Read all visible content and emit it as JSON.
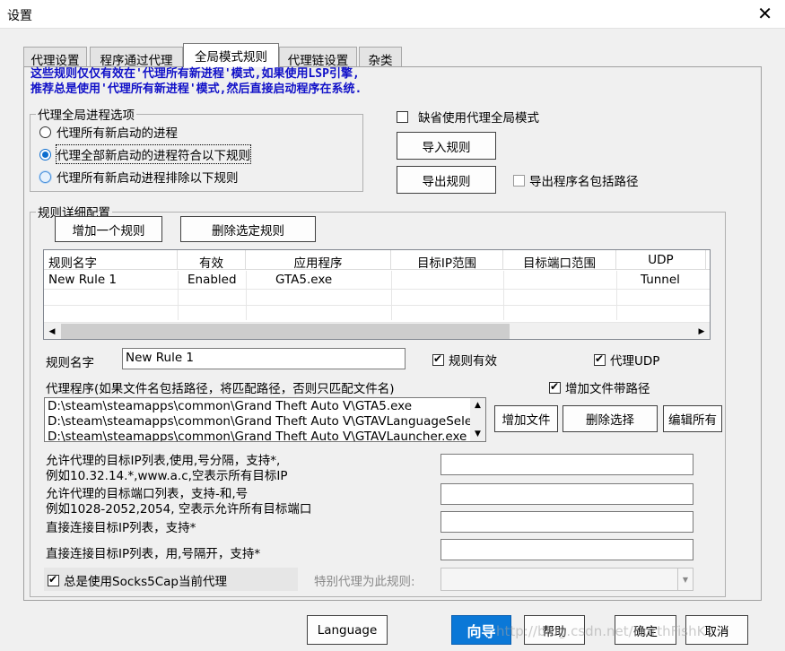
{
  "window": {
    "title": "设置"
  },
  "tabs": [
    {
      "label": "代理设置",
      "active": false
    },
    {
      "label": "程序通过代理",
      "active": false
    },
    {
      "label": "全局模式规则",
      "active": true
    },
    {
      "label": "代理链设置",
      "active": false
    },
    {
      "label": "杂类",
      "active": false
    }
  ],
  "notice": {
    "line1": "这些规则仅仅有效在'代理所有新进程'模式,如果使用LSP引擎,",
    "line2": "推荐总是使用'代理所有新进程'模式,然后直接启动程序在系统."
  },
  "global_options": {
    "legend": "代理全局进程选项",
    "options": [
      {
        "label": "代理所有新启动的进程",
        "selected": false
      },
      {
        "label": "代理全部新启动的进程符合以下规则",
        "selected": true
      },
      {
        "label": "代理所有新启动进程排除以下规则",
        "selected": false
      }
    ]
  },
  "default_global_mode": {
    "label": "缺省使用代理全局模式",
    "checked": false
  },
  "import_rules_label": "导入规则",
  "export_rules_label": "导出规则",
  "export_include_path": {
    "label": "导出程序名包括路径",
    "checked": false
  },
  "rule_detail": {
    "legend": "规则详细配置",
    "add_rule_label": "增加一个规则",
    "delete_rule_label": "删除选定规则",
    "columns": [
      "规则名字",
      "有效",
      "应用程序",
      "目标IP范围",
      "目标端口范围",
      "UDP"
    ],
    "rows": [
      {
        "name": "New Rule 1",
        "enabled": "Enabled",
        "app": "GTA5.exe",
        "ip": "",
        "port": "",
        "udp": "Tunnel"
      }
    ]
  },
  "rule_name": {
    "label": "规则名字",
    "value": "New Rule 1"
  },
  "rule_valid": {
    "label": "规则有效",
    "checked": true
  },
  "proxy_udp": {
    "label": "代理UDP",
    "checked": true
  },
  "proxy_program": {
    "label": "代理程序(如果文件名包括路径，将匹配路径，否则只匹配文件名)",
    "add_path": {
      "label": "增加文件带路径",
      "checked": true
    },
    "files": [
      "D:\\steam\\steamapps\\common\\Grand Theft Auto V\\GTA5.exe",
      "D:\\steam\\steamapps\\common\\Grand Theft Auto V\\GTAVLanguageSelect.exe",
      "D:\\steam\\steamapps\\common\\Grand Theft Auto V\\GTAVLauncher.exe"
    ],
    "add_file_label": "增加文件",
    "delete_selected_label": "删除选择",
    "edit_all_label": "编辑所有"
  },
  "fields": {
    "allowed_ip": {
      "label1": "允许代理的目标IP列表,使用,号分隔，支持*,",
      "label2": "例如10.32.14.*,www.a.c,空表示所有目标IP",
      "value": ""
    },
    "allowed_port": {
      "label1": "允许代理的目标端口列表，支持-和,号",
      "label2": "例如1028-2052,2054, 空表示允许所有目标端口",
      "value": ""
    },
    "direct_ip": {
      "label": "直接连接目标IP列表，支持*",
      "value": ""
    },
    "direct_ip2": {
      "label": "直接连接目标IP列表，用,号隔开，支持*",
      "value": ""
    }
  },
  "always_use": {
    "label": "总是使用Socks5Cap当前代理",
    "checked": true
  },
  "special_proxy": {
    "label": "特别代理为此规则:",
    "value": ""
  },
  "footer": {
    "language_label": "Language",
    "wizard_label": "向导",
    "help_label": "帮助",
    "ok_label": "确定",
    "cancel_label": "取消"
  },
  "watermark": "http://blog.csdn.net/NorthFishK"
}
